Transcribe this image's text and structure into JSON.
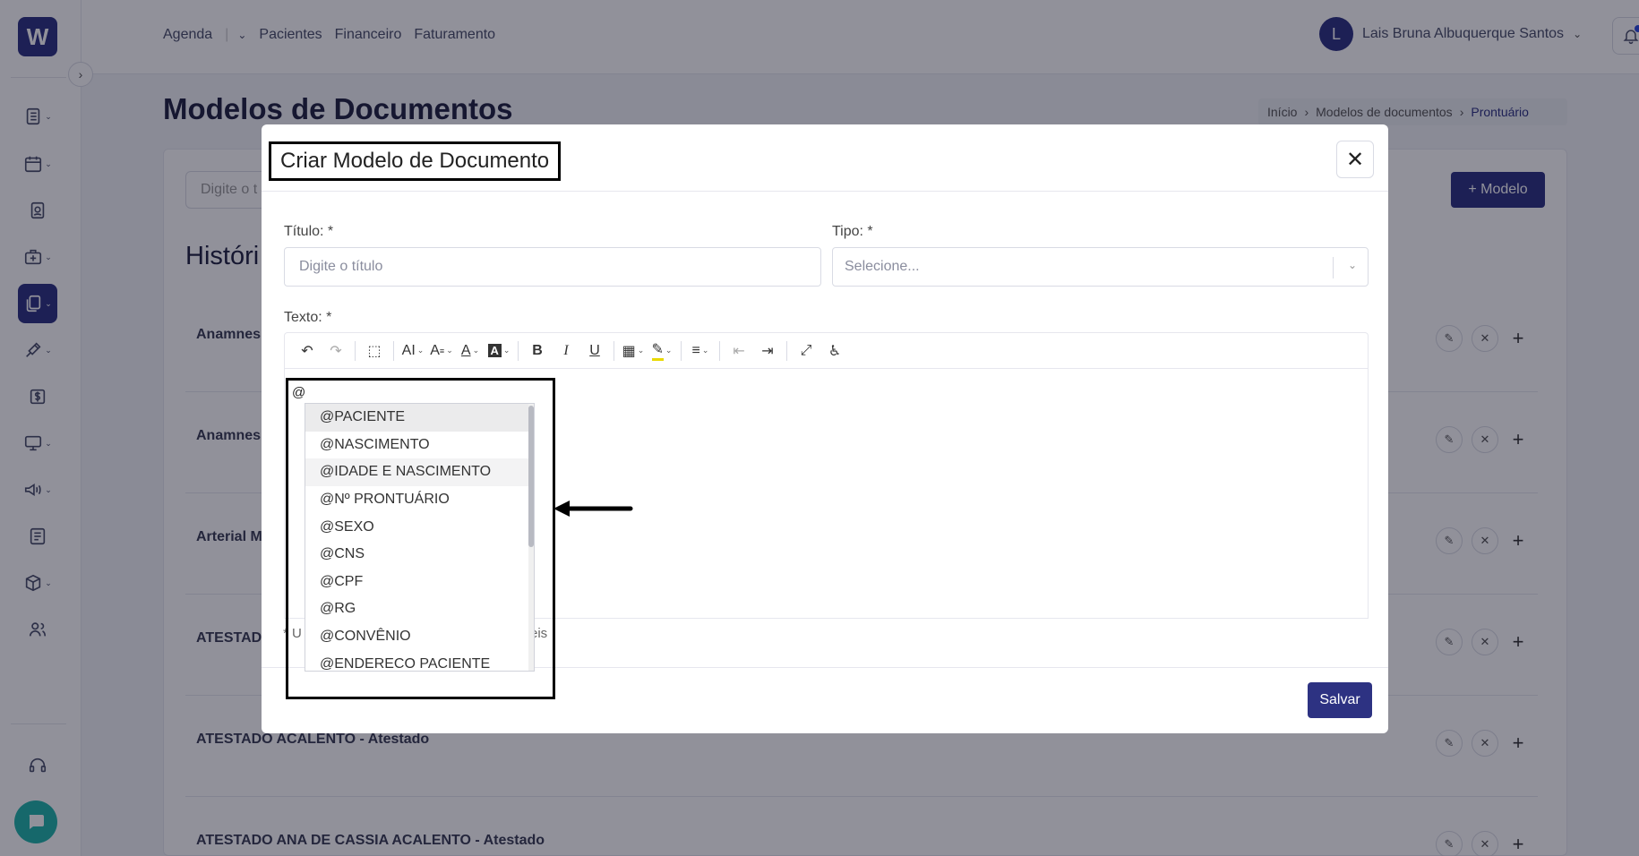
{
  "brand": {
    "logo_text": "W"
  },
  "nav": {
    "agenda": "Agenda",
    "pacientes": "Pacientes",
    "financeiro": "Financeiro",
    "faturamento": "Faturamento"
  },
  "user": {
    "initial": "L",
    "name": "Lais Bruna Albuquerque Santos"
  },
  "page": {
    "title": "Modelos de Documentos",
    "breadcrumb": [
      "Início",
      "Modelos de documentos",
      "Prontuário"
    ],
    "search_placeholder": "Digite o t",
    "add_button": "+ Modelo",
    "history_title": "Históri"
  },
  "list": [
    {
      "title": "Anamnes"
    },
    {
      "title": "Anamnes"
    },
    {
      "title": "Arterial M"
    },
    {
      "title": "ATESTAD"
    },
    {
      "title": "ATESTADO ACALENTO - Atestado"
    },
    {
      "title": "ATESTADO ANA DE CASSIA ACALENTO - Atestado"
    }
  ],
  "modal": {
    "title": "Criar Modelo de Documento",
    "titulo_label": "Título: *",
    "titulo_placeholder": "Digite o título",
    "tipo_label": "Tipo: *",
    "tipo_placeholder": "Selecione...",
    "texto_label": "Texto: *",
    "editor_content": "@",
    "hint_start": "* U",
    "hint_end": "eis",
    "save_button": "Salvar",
    "close_symbol": "✕"
  },
  "mentions": [
    "@PACIENTE",
    "@NASCIMENTO",
    "@IDADE E NASCIMENTO",
    "@Nº PRONTUÁRIO",
    "@SEXO",
    "@CNS",
    "@CPF",
    "@RG",
    "@CONVÊNIO",
    "@ENDERECO PACIENTE"
  ],
  "colors": {
    "primary": "#2d3282",
    "accent": "#1fb5a9",
    "notification": "#2d4be0"
  }
}
